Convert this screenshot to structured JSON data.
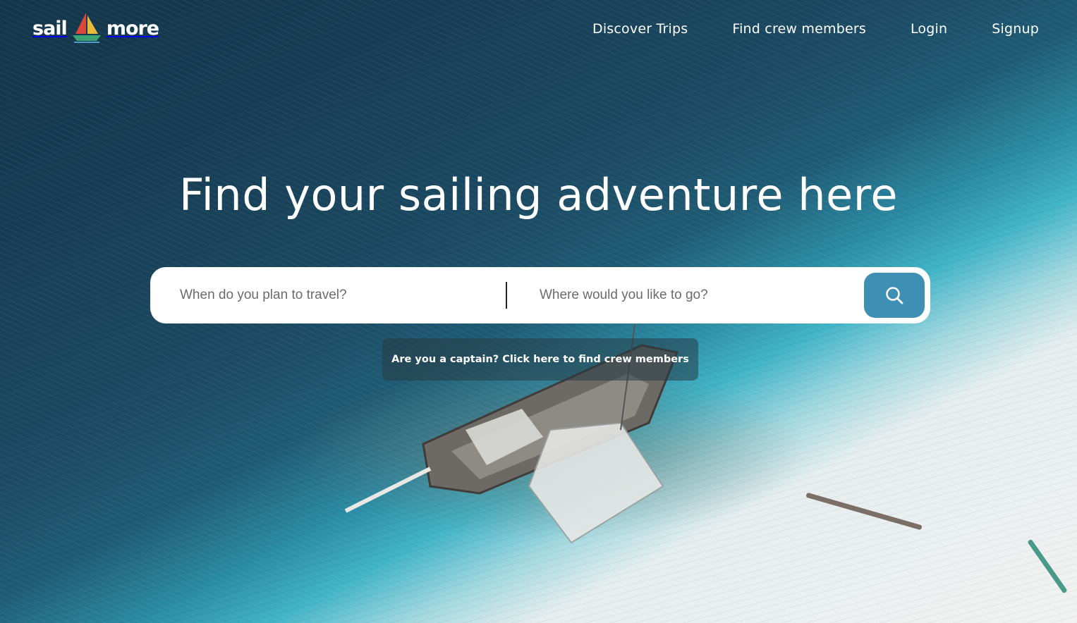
{
  "brand": {
    "logo_left": "sail",
    "logo_right": "more",
    "sail_colors": [
      "#e9b93a",
      "#d9483b",
      "#3aa275"
    ]
  },
  "nav": {
    "items": [
      {
        "label": "Discover Trips"
      },
      {
        "label": "Find crew members"
      },
      {
        "label": "Login"
      },
      {
        "label": "Signup"
      }
    ]
  },
  "hero": {
    "title": "Find your sailing adventure here"
  },
  "search": {
    "date_placeholder": "When do you plan to travel?",
    "destination_placeholder": "Where would you like to go?",
    "button_icon": "search-icon",
    "button_color": "#3d8fb3"
  },
  "captain_cta": {
    "label": "Are you a captain? Click here to find crew members"
  }
}
